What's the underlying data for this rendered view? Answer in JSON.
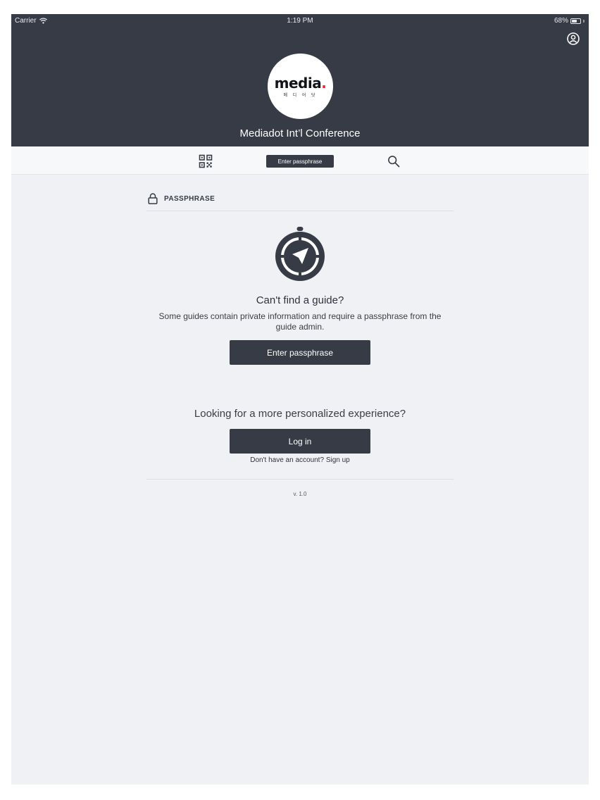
{
  "status_bar": {
    "carrier": "Carrier",
    "time": "1:19 PM",
    "battery_percent": "68%",
    "battery_level": 0.68
  },
  "header": {
    "event_title": "Mediadot Int’l Conference",
    "logo": {
      "word": "media",
      "dot": ".",
      "subtext": "메 디 어 닷"
    },
    "profile_icon": "user-circle-icon"
  },
  "toolbar": {
    "qr_icon": "qr-code-icon",
    "passphrase_button_label": "Enter passphrase",
    "search_icon": "search-icon"
  },
  "passphrase_section": {
    "icon": "lock-icon",
    "label": "PASSPHRASE",
    "illustration_icon": "compass-icon",
    "title": "Can't find a guide?",
    "description": "Some guides contain private information and require a passphrase from the guide admin.",
    "button_label": "Enter passphrase"
  },
  "login_section": {
    "title": "Looking for a more personalized experience?",
    "button_label": "Log in",
    "signup_prompt": "Don't have an account?",
    "signup_link": "Sign up"
  },
  "footer": {
    "version": "v. 1.0"
  },
  "colors": {
    "header_bg": "#373b46",
    "page_bg": "#f0f1f4",
    "button_bg": "#373b46",
    "logo_dot": "#e0282e"
  }
}
